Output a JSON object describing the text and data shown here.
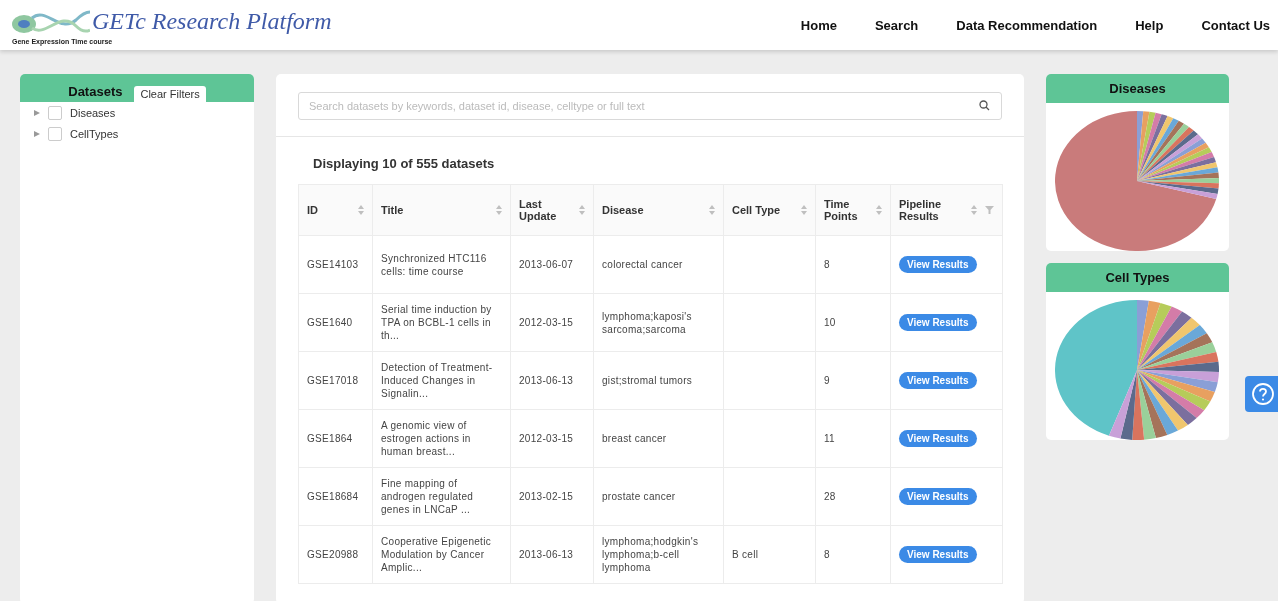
{
  "header": {
    "logo_title": "GETc Research Platform",
    "logo_subtitle": "Gene Expression Time course",
    "nav": [
      "Home",
      "Search",
      "Data Recommendation",
      "Help",
      "Contact Us"
    ]
  },
  "filters": {
    "title": "Datasets",
    "clear_button": "Clear Filters",
    "items": [
      {
        "label": "Diseases",
        "checked": false,
        "expanded": false
      },
      {
        "label": "CellTypes",
        "checked": false,
        "expanded": false
      }
    ]
  },
  "search": {
    "placeholder": "Search datasets by keywords, dataset id, disease, celltype or full text"
  },
  "summary": "Displaying 10 of 555 datasets",
  "table": {
    "columns": [
      {
        "label": "ID",
        "sortable": true,
        "filter": false
      },
      {
        "label": "Title",
        "sortable": true,
        "filter": false
      },
      {
        "label": "Last Update",
        "sortable": true,
        "filter": false
      },
      {
        "label": "Disease",
        "sortable": true,
        "filter": false
      },
      {
        "label": "Cell Type",
        "sortable": true,
        "filter": false
      },
      {
        "label": "Time Points",
        "sortable": true,
        "filter": false
      },
      {
        "label": "Pipeline Results",
        "sortable": true,
        "filter": true
      }
    ],
    "rows": [
      {
        "id": "GSE14103",
        "title": "Synchronized HTC116 cells: time course",
        "last_update": "2013-06-07",
        "disease": "colorectal cancer",
        "cell_type": "",
        "time_points": "8",
        "action": "View Results"
      },
      {
        "id": "GSE1640",
        "title": "Serial time induction by TPA on BCBL-1 cells in th...",
        "last_update": "2012-03-15",
        "disease": "lymphoma;kaposi's sarcoma;sarcoma",
        "cell_type": "",
        "time_points": "10",
        "action": "View Results"
      },
      {
        "id": "GSE17018",
        "title": "Detection of Treatment-Induced Changes in Signalin...",
        "last_update": "2013-06-13",
        "disease": "gist;stromal tumors",
        "cell_type": "",
        "time_points": "9",
        "action": "View Results"
      },
      {
        "id": "GSE1864",
        "title": "A genomic view of estrogen actions in human breast...",
        "last_update": "2012-03-15",
        "disease": "breast cancer",
        "cell_type": "",
        "time_points": "11",
        "action": "View Results"
      },
      {
        "id": "GSE18684",
        "title": "Fine mapping of androgen regulated genes in LNCaP ...",
        "last_update": "2013-02-15",
        "disease": "prostate cancer",
        "cell_type": "",
        "time_points": "28",
        "action": "View Results"
      },
      {
        "id": "GSE20988",
        "title": "Cooperative Epigenetic Modulation by Cancer Amplic...",
        "last_update": "2013-06-13",
        "disease": "lymphoma;hodgkin's lymphoma;b-cell lymphoma",
        "cell_type": "B cell",
        "time_points": "8",
        "action": "View Results"
      }
    ]
  },
  "charts": [
    {
      "title": "Diseases",
      "kind": "diseases"
    },
    {
      "title": "Cell Types",
      "kind": "cell_types"
    }
  ]
}
